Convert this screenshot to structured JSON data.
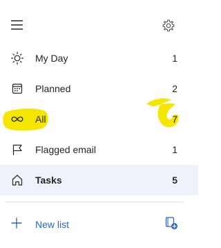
{
  "header": {
    "menu_icon": "hamburger-icon",
    "settings_icon": "gear-icon"
  },
  "nav": {
    "items": [
      {
        "label": "My Day",
        "count": "1",
        "icon": "sun-icon",
        "selected": false
      },
      {
        "label": "Planned",
        "count": "2",
        "icon": "calendar-icon",
        "selected": false
      },
      {
        "label": "All",
        "count": "7",
        "icon": "infinity-icon",
        "selected": false
      },
      {
        "label": "Flagged email",
        "count": "1",
        "icon": "flag-icon",
        "selected": false
      },
      {
        "label": "Tasks",
        "count": "5",
        "icon": "home-icon",
        "selected": true
      }
    ]
  },
  "footer": {
    "new_list_label": "New list",
    "new_list_icon": "plus-icon",
    "new_group_icon": "new-group-icon"
  },
  "colors": {
    "accent": "#2564cf",
    "selected_bg": "#eef3fb",
    "highlight": "#f5e600",
    "text": "#252423"
  }
}
